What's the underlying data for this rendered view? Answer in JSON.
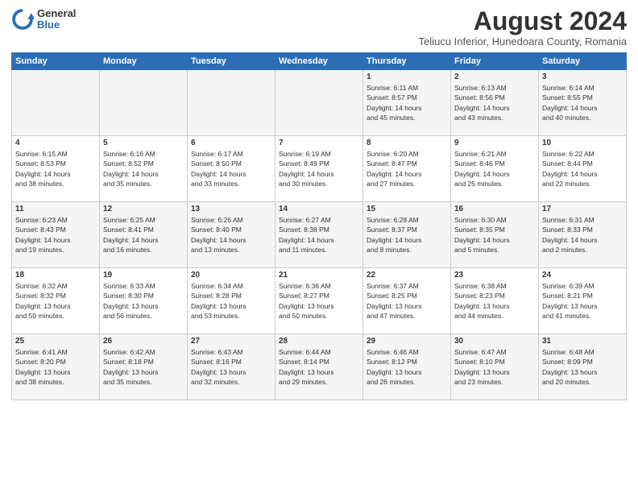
{
  "header": {
    "logo_general": "General",
    "logo_blue": "Blue",
    "month_title": "August 2024",
    "location": "Teliucu Inferior, Hunedoara County, Romania"
  },
  "weekdays": [
    "Sunday",
    "Monday",
    "Tuesday",
    "Wednesday",
    "Thursday",
    "Friday",
    "Saturday"
  ],
  "weeks": [
    [
      {
        "day": "",
        "info": ""
      },
      {
        "day": "",
        "info": ""
      },
      {
        "day": "",
        "info": ""
      },
      {
        "day": "",
        "info": ""
      },
      {
        "day": "1",
        "info": "Sunrise: 6:11 AM\nSunset: 8:57 PM\nDaylight: 14 hours\nand 45 minutes."
      },
      {
        "day": "2",
        "info": "Sunrise: 6:13 AM\nSunset: 8:56 PM\nDaylight: 14 hours\nand 43 minutes."
      },
      {
        "day": "3",
        "info": "Sunrise: 6:14 AM\nSunset: 8:55 PM\nDaylight: 14 hours\nand 40 minutes."
      }
    ],
    [
      {
        "day": "4",
        "info": "Sunrise: 6:15 AM\nSunset: 8:53 PM\nDaylight: 14 hours\nand 38 minutes."
      },
      {
        "day": "5",
        "info": "Sunrise: 6:16 AM\nSunset: 8:52 PM\nDaylight: 14 hours\nand 35 minutes."
      },
      {
        "day": "6",
        "info": "Sunrise: 6:17 AM\nSunset: 8:50 PM\nDaylight: 14 hours\nand 33 minutes."
      },
      {
        "day": "7",
        "info": "Sunrise: 6:19 AM\nSunset: 8:49 PM\nDaylight: 14 hours\nand 30 minutes."
      },
      {
        "day": "8",
        "info": "Sunrise: 6:20 AM\nSunset: 8:47 PM\nDaylight: 14 hours\nand 27 minutes."
      },
      {
        "day": "9",
        "info": "Sunrise: 6:21 AM\nSunset: 8:46 PM\nDaylight: 14 hours\nand 25 minutes."
      },
      {
        "day": "10",
        "info": "Sunrise: 6:22 AM\nSunset: 8:44 PM\nDaylight: 14 hours\nand 22 minutes."
      }
    ],
    [
      {
        "day": "11",
        "info": "Sunrise: 6:23 AM\nSunset: 8:43 PM\nDaylight: 14 hours\nand 19 minutes."
      },
      {
        "day": "12",
        "info": "Sunrise: 6:25 AM\nSunset: 8:41 PM\nDaylight: 14 hours\nand 16 minutes."
      },
      {
        "day": "13",
        "info": "Sunrise: 6:26 AM\nSunset: 8:40 PM\nDaylight: 14 hours\nand 13 minutes."
      },
      {
        "day": "14",
        "info": "Sunrise: 6:27 AM\nSunset: 8:38 PM\nDaylight: 14 hours\nand 11 minutes."
      },
      {
        "day": "15",
        "info": "Sunrise: 6:28 AM\nSunset: 8:37 PM\nDaylight: 14 hours\nand 8 minutes."
      },
      {
        "day": "16",
        "info": "Sunrise: 6:30 AM\nSunset: 8:35 PM\nDaylight: 14 hours\nand 5 minutes."
      },
      {
        "day": "17",
        "info": "Sunrise: 6:31 AM\nSunset: 8:33 PM\nDaylight: 14 hours\nand 2 minutes."
      }
    ],
    [
      {
        "day": "18",
        "info": "Sunrise: 6:32 AM\nSunset: 8:32 PM\nDaylight: 13 hours\nand 59 minutes."
      },
      {
        "day": "19",
        "info": "Sunrise: 6:33 AM\nSunset: 8:30 PM\nDaylight: 13 hours\nand 56 minutes."
      },
      {
        "day": "20",
        "info": "Sunrise: 6:34 AM\nSunset: 8:28 PM\nDaylight: 13 hours\nand 53 minutes."
      },
      {
        "day": "21",
        "info": "Sunrise: 6:36 AM\nSunset: 8:27 PM\nDaylight: 13 hours\nand 50 minutes."
      },
      {
        "day": "22",
        "info": "Sunrise: 6:37 AM\nSunset: 8:25 PM\nDaylight: 13 hours\nand 47 minutes."
      },
      {
        "day": "23",
        "info": "Sunrise: 6:38 AM\nSunset: 8:23 PM\nDaylight: 13 hours\nand 44 minutes."
      },
      {
        "day": "24",
        "info": "Sunrise: 6:39 AM\nSunset: 8:21 PM\nDaylight: 13 hours\nand 41 minutes."
      }
    ],
    [
      {
        "day": "25",
        "info": "Sunrise: 6:41 AM\nSunset: 8:20 PM\nDaylight: 13 hours\nand 38 minutes."
      },
      {
        "day": "26",
        "info": "Sunrise: 6:42 AM\nSunset: 8:18 PM\nDaylight: 13 hours\nand 35 minutes."
      },
      {
        "day": "27",
        "info": "Sunrise: 6:43 AM\nSunset: 8:16 PM\nDaylight: 13 hours\nand 32 minutes."
      },
      {
        "day": "28",
        "info": "Sunrise: 6:44 AM\nSunset: 8:14 PM\nDaylight: 13 hours\nand 29 minutes."
      },
      {
        "day": "29",
        "info": "Sunrise: 6:46 AM\nSunset: 8:12 PM\nDaylight: 13 hours\nand 26 minutes."
      },
      {
        "day": "30",
        "info": "Sunrise: 6:47 AM\nSunset: 8:10 PM\nDaylight: 13 hours\nand 23 minutes."
      },
      {
        "day": "31",
        "info": "Sunrise: 6:48 AM\nSunset: 8:09 PM\nDaylight: 13 hours\nand 20 minutes."
      }
    ]
  ]
}
